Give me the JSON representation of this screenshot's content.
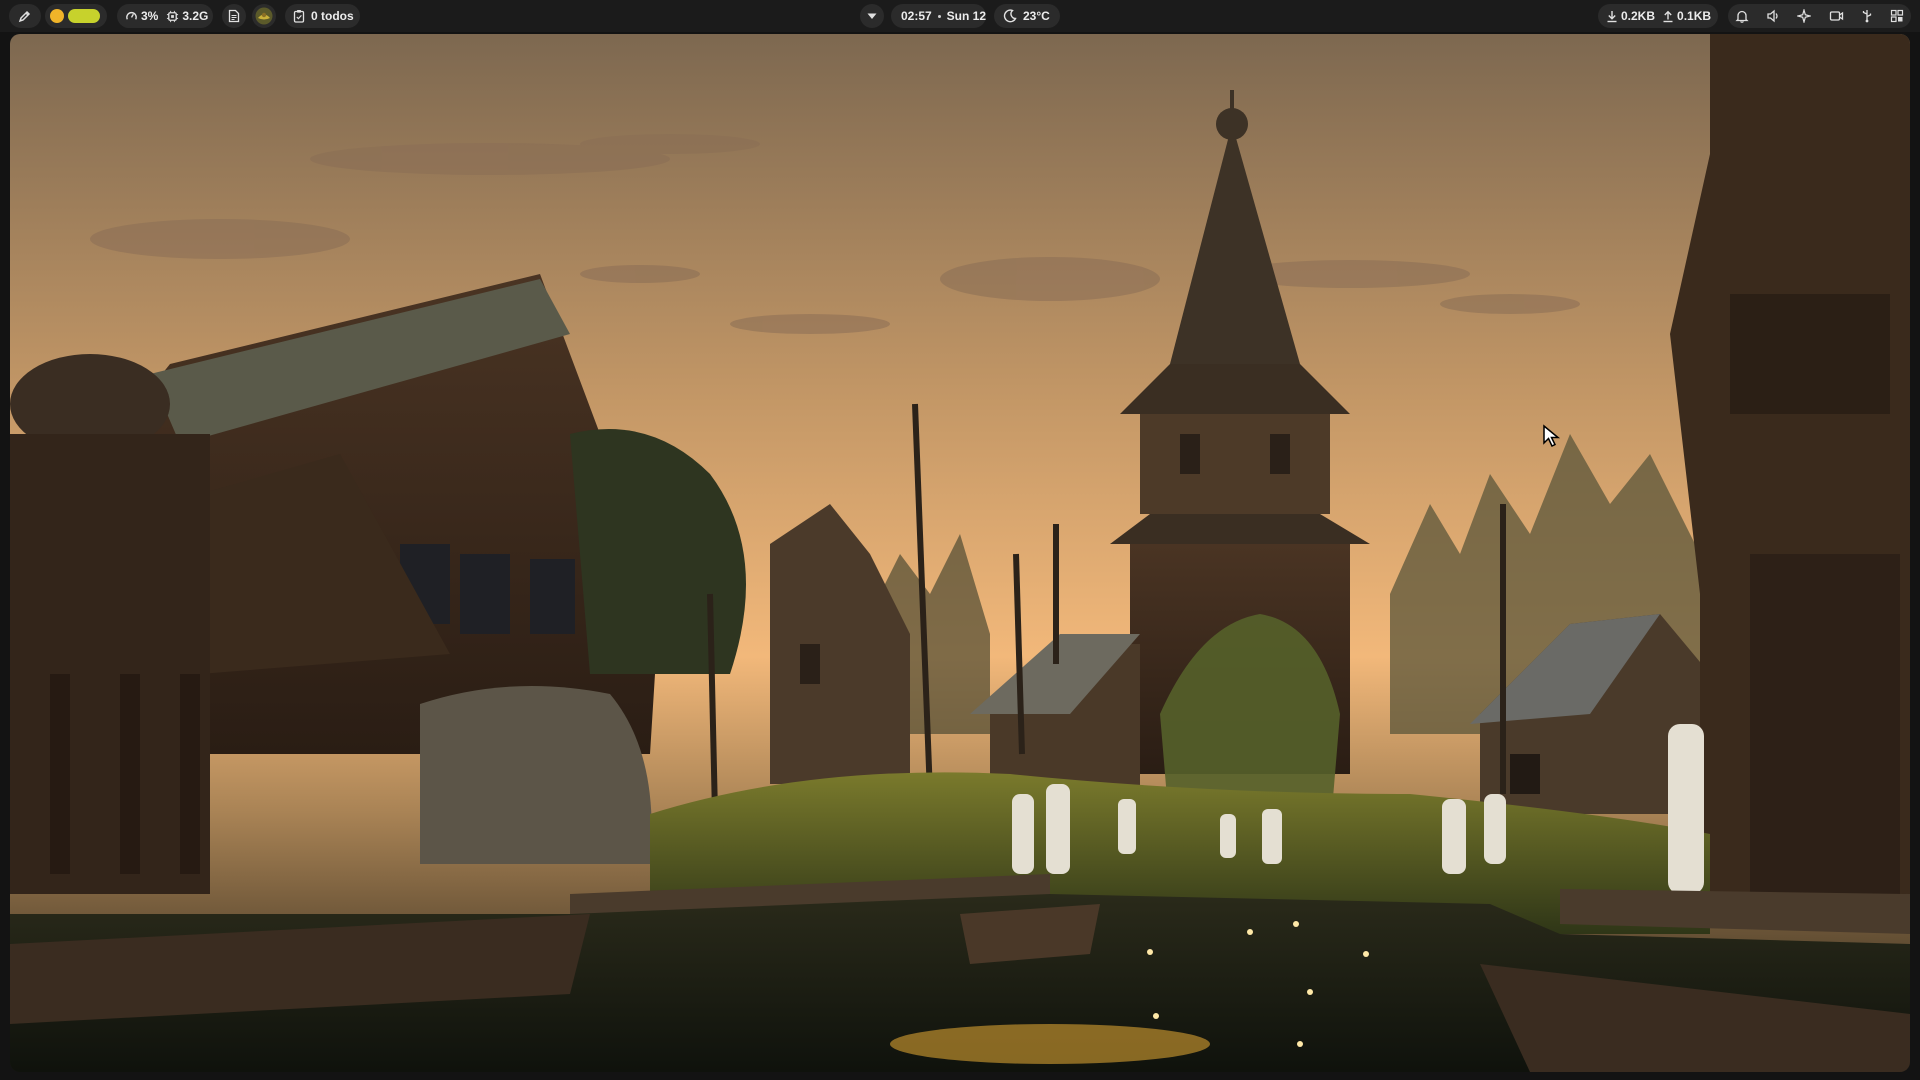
{
  "topbar": {
    "cpu": "3%",
    "memory": "3.2G",
    "todos": "0 todos",
    "time": "02:57",
    "date": "Sun 12",
    "temperature": "23°C",
    "download": "0.2KB",
    "upload": "0.1KB",
    "icons": [
      "edit-icon",
      "status-dot-icon",
      "cpu-gauge-icon",
      "memory-chip-icon",
      "document-icon",
      "app-avatar-icon",
      "clipboard-icon",
      "chevron-down-icon",
      "weather-moon-icon",
      "download-arrow-icon",
      "upload-arrow-icon",
      "bell-icon",
      "volume-icon",
      "sparkle-icon",
      "camera-icon",
      "usb-icon",
      "grid-icon"
    ]
  },
  "colors": {
    "bar": "#1b1b1b",
    "pill": "#2b2b2b",
    "accent_yellow": "#c7d22c",
    "dot_orange": "#f0b429",
    "sky_top": "#7d6850",
    "sky_horizon": "#f2b87a"
  },
  "wallpaper": {
    "subject": "wooden-village-at-dusk"
  }
}
